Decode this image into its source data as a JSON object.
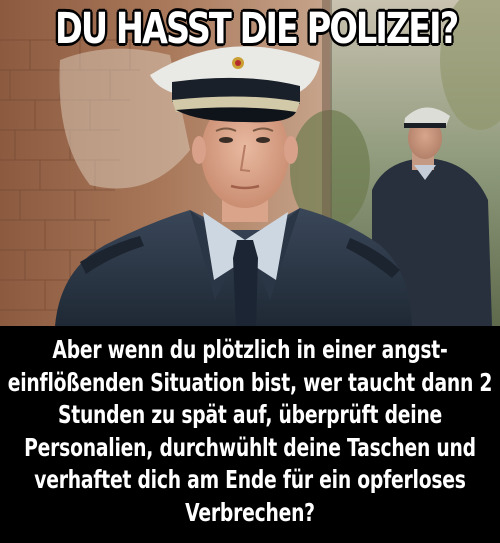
{
  "meme": {
    "top_text": "DU HASST DIE POLIZEI?",
    "bottom_text": "Aber wenn du plötzlich in einer angst-einflößenden Situation bist, wer taucht dann 2 Stunden zu spät auf, überprüft deine Personalien, durchwühlt deine Taschen und verhaftet dich am Ende für ein opferloses Verbrechen?"
  },
  "colors": {
    "caption_text": "#ffffff",
    "caption_background": "#000000",
    "uniform": "#2e3b4d",
    "cap_top": "#e9e9e6",
    "brick": "#a86a4a"
  }
}
